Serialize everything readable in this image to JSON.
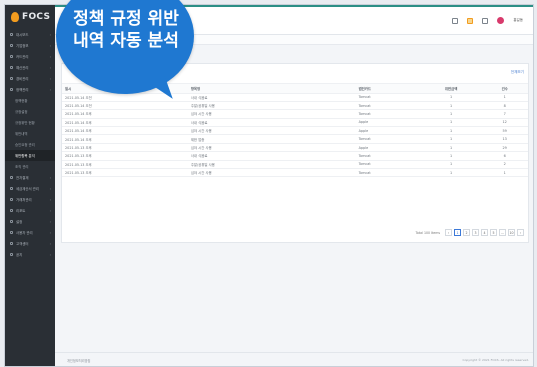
{
  "callout": {
    "line1": "정책 규정 위반",
    "line2": "내역 자동 분석"
  },
  "brand": {
    "logo_text": "FOCS"
  },
  "sidebar": {
    "items": [
      {
        "label": "대시보드",
        "type": "item",
        "active": false
      },
      {
        "label": "기업정보",
        "type": "item",
        "active": false
      },
      {
        "label": "카드관리",
        "type": "item",
        "active": false
      },
      {
        "label": "예산관리",
        "type": "item",
        "active": false
      },
      {
        "label": "경비관리",
        "type": "item",
        "active": false
      },
      {
        "label": "정책관리",
        "type": "item",
        "active": false
      },
      {
        "label": "정책현황",
        "type": "sub",
        "active": false
      },
      {
        "label": "규정설정",
        "type": "sub",
        "active": false
      },
      {
        "label": "규정위반 현황",
        "type": "sub",
        "active": false
      },
      {
        "label": "위반내역",
        "type": "sub",
        "active": false
      },
      {
        "label": "승인요청 관리",
        "type": "sub",
        "active": false
      },
      {
        "label": "위반항목 분석",
        "type": "sub",
        "active": true
      },
      {
        "label": "조직 관리",
        "type": "sub",
        "active": false
      },
      {
        "label": "전자결재",
        "type": "item",
        "active": false
      },
      {
        "label": "세금계산서 관리",
        "type": "item",
        "active": false
      },
      {
        "label": "거래처관리",
        "type": "item",
        "active": false
      },
      {
        "label": "리포트",
        "type": "item",
        "active": false
      },
      {
        "label": "설정",
        "type": "item",
        "active": false
      },
      {
        "label": "사용자 관리",
        "type": "item",
        "active": false
      },
      {
        "label": "고객센터",
        "type": "item",
        "active": false
      },
      {
        "label": "공지",
        "type": "item",
        "active": false
      }
    ]
  },
  "header": {
    "user_name": "홍길동"
  },
  "table": {
    "link_label": "전체보기",
    "columns": [
      "일시",
      "항목명",
      "법인카드",
      "위반금액",
      "건수"
    ],
    "rows": [
      [
        "2021.05.14 오전",
        "사내 식음료",
        "Tomcat",
        "1",
        "1"
      ],
      [
        "2021.05.14 오전",
        "주말/공휴일 사용",
        "Tomcat",
        "1",
        "8"
      ],
      [
        "2021.05.14 오후",
        "심야 시간 사용",
        "Tomcat",
        "1",
        "7"
      ],
      [
        "2021.05.14 오후",
        "사내 식음료",
        "Apple",
        "1",
        "12"
      ],
      [
        "2021.05.14 오후",
        "심야 시간 사용",
        "Apple",
        "1",
        "59"
      ],
      [
        "2021.05.14 오후",
        "제한 업종",
        "Tomcat",
        "1",
        "13"
      ],
      [
        "2021.05.13 오후",
        "심야 시간 사용",
        "Apple",
        "1",
        "29"
      ],
      [
        "2021.05.13 오후",
        "사내 식음료",
        "Tomcat",
        "1",
        "6"
      ],
      [
        "2021.05.13 오후",
        "주말/공휴일 사용",
        "Tomcat",
        "1",
        "2"
      ],
      [
        "2021.05.13 오후",
        "심야 시간 사용",
        "Tomcat",
        "1",
        "1"
      ]
    ],
    "pager": {
      "total_label": "Total 100 Items",
      "pages": [
        "‹",
        "1",
        "2",
        "3",
        "4",
        "5",
        "…",
        "10",
        "›"
      ]
    }
  },
  "footer": {
    "left": "개인정보처리방침",
    "right": "Copyright © 2021 FOCS. All rights reserved."
  }
}
